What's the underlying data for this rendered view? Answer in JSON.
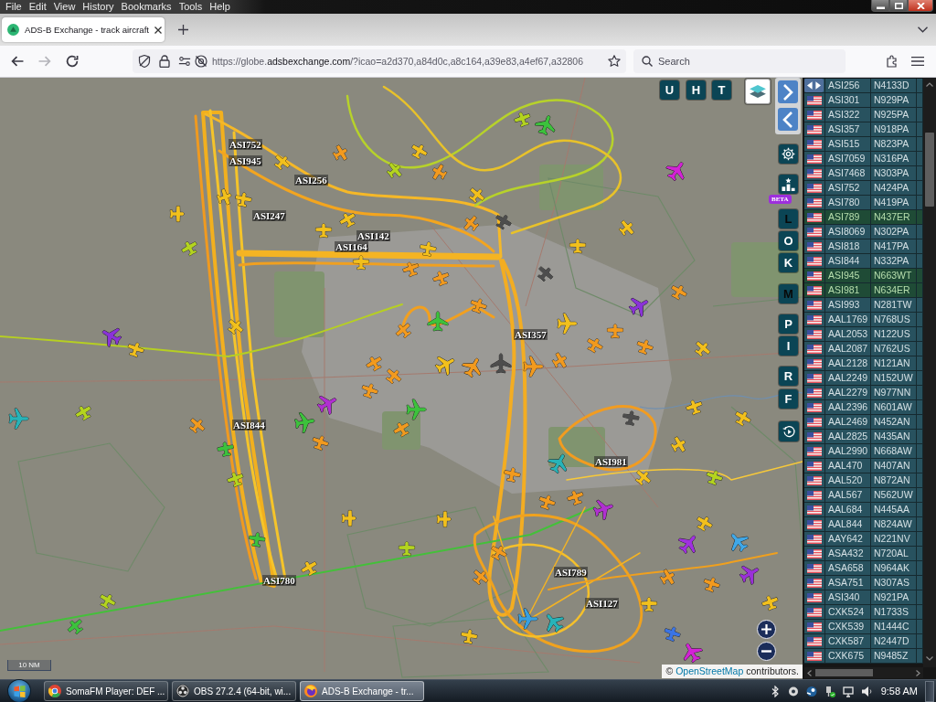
{
  "menu_bar": [
    "File",
    "Edit",
    "View",
    "History",
    "Bookmarks",
    "Tools",
    "Help"
  ],
  "tabs": [
    {
      "title": "ADS-B Exchange - track aircraft",
      "selected": true
    }
  ],
  "toolbar": {
    "nav_buttons": [
      {
        "kind": "back",
        "disabled": false
      },
      {
        "kind": "forward",
        "disabled": true
      },
      {
        "kind": "reload",
        "disabled": false
      }
    ],
    "url": {
      "prefix": "https://globe.",
      "domain": "adsbexchange.com",
      "path": "/?icao=a2d370,a84d0c,a8c164,a39e83,a4ef67,a32806"
    },
    "search": {
      "placeholder": "Search"
    }
  },
  "map": {
    "top_buttons": [
      {
        "kind": "letter",
        "label": "U",
        "on": false
      },
      {
        "kind": "letter",
        "label": "H",
        "on": false
      },
      {
        "kind": "letter",
        "label": "T",
        "on": false
      },
      {
        "kind": "layers"
      }
    ],
    "side_buttons": [
      {
        "kind": "next"
      },
      {
        "kind": "previous"
      },
      {
        "kind": "settings"
      },
      {
        "kind": "beta",
        "badge": "BETA"
      },
      {
        "kind": "letter",
        "label": "L",
        "on": true
      },
      {
        "kind": "letter",
        "label": "O",
        "on": false
      },
      {
        "kind": "letter",
        "label": "K",
        "on": false
      },
      {
        "kind": "letter",
        "label": "M",
        "on": true
      },
      {
        "kind": "letter",
        "label": "P",
        "on": false
      },
      {
        "kind": "letter",
        "label": "I",
        "on": false
      },
      {
        "kind": "letter",
        "label": "R",
        "on": false
      },
      {
        "kind": "letter",
        "label": "F",
        "on": false
      },
      {
        "kind": "replay"
      }
    ],
    "aircraft": [
      {
        "kind": "jet",
        "color": "#d322d6"
      },
      {
        "kind": "jet",
        "color": "#3cc23c"
      },
      {
        "kind": "prop",
        "color": "#b4d41e"
      },
      {
        "kind": "prop",
        "color": "#f29a1e"
      },
      {
        "kind": "prop",
        "color": "#f2c01c"
      },
      {
        "kind": "prop",
        "color": "#f2c01c"
      },
      {
        "kind": "prop",
        "color": "#b4d41e"
      },
      {
        "kind": "prop",
        "color": "#f2c01c"
      },
      {
        "kind": "prop",
        "color": "#f2c01c"
      },
      {
        "kind": "prop",
        "color": "#b4d41e"
      },
      {
        "kind": "prop",
        "color": "#f2c01c"
      },
      {
        "kind": "prop",
        "color": "#f29a1e"
      },
      {
        "kind": "prop",
        "color": "#f2c01c"
      },
      {
        "kind": "prop",
        "color": "#f2c01c"
      },
      {
        "kind": "prop",
        "color": "#f2c01c"
      },
      {
        "kind": "prop",
        "color": "#f2c01c"
      },
      {
        "kind": "prop",
        "color": "#f29a1e"
      },
      {
        "kind": "prop",
        "color": "#f2c01c"
      },
      {
        "kind": "prop",
        "color": "#4d4d4d"
      },
      {
        "kind": "prop",
        "color": "#f29a1e"
      },
      {
        "kind": "prop",
        "color": "#f2c01c"
      },
      {
        "kind": "prop",
        "color": "#f2c01c"
      },
      {
        "kind": "prop",
        "color": "#4d4d4d"
      },
      {
        "kind": "prop",
        "color": "#f29a1e"
      },
      {
        "kind": "jet",
        "color": "#3cc23c"
      },
      {
        "kind": "prop",
        "color": "#f29a1e"
      },
      {
        "kind": "prop",
        "color": "#f29a1e"
      },
      {
        "kind": "jet",
        "color": "#f2c01c"
      },
      {
        "kind": "jet",
        "color": "#8a32d8"
      },
      {
        "kind": "prop",
        "color": "#f29a1e"
      },
      {
        "kind": "jet",
        "color": "#8a32d8"
      },
      {
        "kind": "prop",
        "color": "#f2c01c"
      },
      {
        "kind": "prop",
        "color": "#f2c01c"
      },
      {
        "kind": "jet",
        "color": "#27b3b8"
      },
      {
        "kind": "prop",
        "color": "#b4d41e"
      },
      {
        "kind": "prop",
        "color": "#f29a1e"
      },
      {
        "kind": "prop",
        "color": "#3cc23c"
      },
      {
        "kind": "prop",
        "color": "#b4d41e"
      },
      {
        "kind": "jet",
        "color": "#b030d0"
      },
      {
        "kind": "jet",
        "color": "#3cc23c"
      },
      {
        "kind": "jet",
        "color": "#3cc23c"
      },
      {
        "kind": "prop",
        "color": "#f29a1e"
      },
      {
        "kind": "prop",
        "color": "#f29a1e"
      },
      {
        "kind": "prop",
        "color": "#f29a1e"
      },
      {
        "kind": "prop",
        "color": "#f29a1e"
      },
      {
        "kind": "prop",
        "color": "#f29a1e"
      },
      {
        "kind": "prop",
        "color": "#f2c01c"
      },
      {
        "kind": "prop",
        "color": "#b4d41e"
      },
      {
        "kind": "prop",
        "color": "#f2c01c"
      },
      {
        "kind": "prop",
        "color": "#3cc23c"
      },
      {
        "kind": "prop",
        "color": "#f2c01c"
      },
      {
        "kind": "prop",
        "color": "#b4d41e"
      },
      {
        "kind": "prop",
        "color": "#3cc23c"
      },
      {
        "kind": "jet",
        "color": "#f2c01c"
      },
      {
        "kind": "jet",
        "color": "#f29a1e"
      },
      {
        "kind": "jet",
        "color": "#4d4d4d"
      },
      {
        "kind": "jet",
        "color": "#f29a1e"
      },
      {
        "kind": "prop",
        "color": "#f29a1e"
      },
      {
        "kind": "prop",
        "color": "#f29a1e"
      },
      {
        "kind": "prop",
        "color": "#f29a1e"
      },
      {
        "kind": "prop",
        "color": "#f29a1e"
      },
      {
        "kind": "prop",
        "color": "#f2c01c"
      },
      {
        "kind": "prop",
        "color": "#4d4d4d"
      },
      {
        "kind": "jet",
        "color": "#27b3b8"
      },
      {
        "kind": "jet",
        "color": "#b030d0"
      },
      {
        "kind": "prop",
        "color": "#f2c01c"
      },
      {
        "kind": "prop",
        "color": "#f2c01c"
      },
      {
        "kind": "prop",
        "color": "#f2c01c"
      },
      {
        "kind": "prop",
        "color": "#b4d41e"
      },
      {
        "kind": "prop",
        "color": "#f2c01c"
      },
      {
        "kind": "jet",
        "color": "#a030e0"
      },
      {
        "kind": "jet",
        "color": "#40a8e8"
      },
      {
        "kind": "jet",
        "color": "#9a30d8"
      },
      {
        "kind": "prop",
        "color": "#f2c01c"
      },
      {
        "kind": "prop",
        "color": "#f2c01c"
      },
      {
        "kind": "prop",
        "color": "#3a74e6"
      },
      {
        "kind": "jet",
        "color": "#d322d6"
      },
      {
        "kind": "jet",
        "color": "#38a0e0"
      },
      {
        "kind": "jet",
        "color": "#27b3b8"
      },
      {
        "kind": "prop",
        "color": "#f29a1e"
      },
      {
        "kind": "prop",
        "color": "#f29a1e"
      },
      {
        "kind": "prop",
        "color": "#f2c01c"
      },
      {
        "kind": "prop",
        "color": "#f29a1e"
      },
      {
        "kind": "prop",
        "color": "#f29a1e"
      },
      {
        "kind": "prop",
        "color": "#f2c01c"
      },
      {
        "kind": "prop",
        "color": "#f29a1e"
      },
      {
        "kind": "prop",
        "color": "#f29a1e"
      },
      {
        "kind": "prop",
        "color": "#f29a1e"
      }
    ],
    "labels": [
      "ASI752",
      "ASI945",
      "ASI256",
      "ASI247",
      "ASI142",
      "ASI164",
      "ASI357",
      "ASI844",
      "ASI981",
      "ASI789",
      "ASI780",
      "ASI127"
    ],
    "scale": "10 NM",
    "attribution": {
      "prefix": "©",
      "link": "OpenStreetMap",
      "suffix": "contributors."
    }
  },
  "sidebar": {
    "rows": [
      {
        "callsign": "ASI256",
        "registration": "N4133D",
        "selected": false
      },
      {
        "callsign": "ASI301",
        "registration": "N929PA",
        "selected": false
      },
      {
        "callsign": "ASI322",
        "registration": "N925PA",
        "selected": false
      },
      {
        "callsign": "ASI357",
        "registration": "N918PA",
        "selected": false
      },
      {
        "callsign": "ASI515",
        "registration": "N823PA",
        "selected": false
      },
      {
        "callsign": "ASI7059",
        "registration": "N316PA",
        "selected": false
      },
      {
        "callsign": "ASI7468",
        "registration": "N303PA",
        "selected": false
      },
      {
        "callsign": "ASI752",
        "registration": "N424PA",
        "selected": false
      },
      {
        "callsign": "ASI780",
        "registration": "N419PA",
        "selected": false
      },
      {
        "callsign": "ASI789",
        "registration": "N437ER",
        "selected": true
      },
      {
        "callsign": "ASI8069",
        "registration": "N302PA",
        "selected": false
      },
      {
        "callsign": "ASI818",
        "registration": "N417PA",
        "selected": false
      },
      {
        "callsign": "ASI844",
        "registration": "N332PA",
        "selected": false
      },
      {
        "callsign": "ASI945",
        "registration": "N663WT",
        "selected": true
      },
      {
        "callsign": "ASI981",
        "registration": "N634ER",
        "selected": true
      },
      {
        "callsign": "ASI993",
        "registration": "N281TW",
        "selected": false
      },
      {
        "callsign": "AAL1769",
        "registration": "N768US",
        "selected": false
      },
      {
        "callsign": "AAL2053",
        "registration": "N122US",
        "selected": false
      },
      {
        "callsign": "AAL2087",
        "registration": "N762US",
        "selected": false
      },
      {
        "callsign": "AAL2128",
        "registration": "N121AN",
        "selected": false
      },
      {
        "callsign": "AAL2249",
        "registration": "N152UW",
        "selected": false
      },
      {
        "callsign": "AAL2279",
        "registration": "N977NN",
        "selected": false
      },
      {
        "callsign": "AAL2396",
        "registration": "N601AW",
        "selected": false
      },
      {
        "callsign": "AAL2469",
        "registration": "N452AN",
        "selected": false
      },
      {
        "callsign": "AAL2825",
        "registration": "N435AN",
        "selected": false
      },
      {
        "callsign": "AAL2990",
        "registration": "N668AW",
        "selected": false
      },
      {
        "callsign": "AAL470",
        "registration": "N407AN",
        "selected": false
      },
      {
        "callsign": "AAL520",
        "registration": "N872AN",
        "selected": false
      },
      {
        "callsign": "AAL567",
        "registration": "N562UW",
        "selected": false
      },
      {
        "callsign": "AAL684",
        "registration": "N445AA",
        "selected": false
      },
      {
        "callsign": "AAL844",
        "registration": "N824AW",
        "selected": false
      },
      {
        "callsign": "AAY642",
        "registration": "N221NV",
        "selected": false
      },
      {
        "callsign": "ASA432",
        "registration": "N720AL",
        "selected": false
      },
      {
        "callsign": "ASA658",
        "registration": "N964AK",
        "selected": false
      },
      {
        "callsign": "ASA751",
        "registration": "N307AS",
        "selected": false
      },
      {
        "callsign": "ASI340",
        "registration": "N921PA",
        "selected": false
      },
      {
        "callsign": "CXK524",
        "registration": "N1733S",
        "selected": false
      },
      {
        "callsign": "CXK539",
        "registration": "N1444C",
        "selected": false
      },
      {
        "callsign": "CXK587",
        "registration": "N2447D",
        "selected": false
      },
      {
        "callsign": "CXK675",
        "registration": "N9485Z",
        "selected": false
      }
    ]
  },
  "taskbar": {
    "tasks": [
      {
        "label": "SomaFM Player: DEF ...",
        "selected": false
      },
      {
        "label": "OBS 27.2.4 (64-bit, wi...",
        "selected": false
      },
      {
        "label": "ADS-B Exchange - tr...",
        "selected": true
      }
    ],
    "clock": "9:58 AM"
  }
}
